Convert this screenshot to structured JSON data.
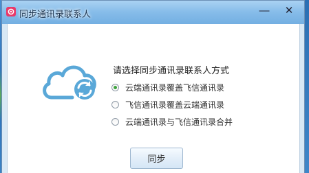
{
  "window": {
    "title": "同步通讯录联系人",
    "controls": {
      "minimize": "—",
      "close": "✕"
    }
  },
  "main": {
    "heading": "请选择同步通讯录联系人方式",
    "options": [
      {
        "label": "云端通讯录覆盖飞信通讯录",
        "checked": true
      },
      {
        "label": "飞信通讯录覆盖云端通讯录",
        "checked": false
      },
      {
        "label": "云端通讯录与飞信通讯录合并",
        "checked": false
      }
    ],
    "sync_button": "同步"
  },
  "colors": {
    "title_bar": "#86bce9",
    "accent_icon": "#5aa8d8",
    "app_icon": "#e8396a",
    "radio_selected": "#3ea23e"
  },
  "icons": {
    "app": "fetion-icon",
    "cloud": "cloud-sync-icon"
  }
}
